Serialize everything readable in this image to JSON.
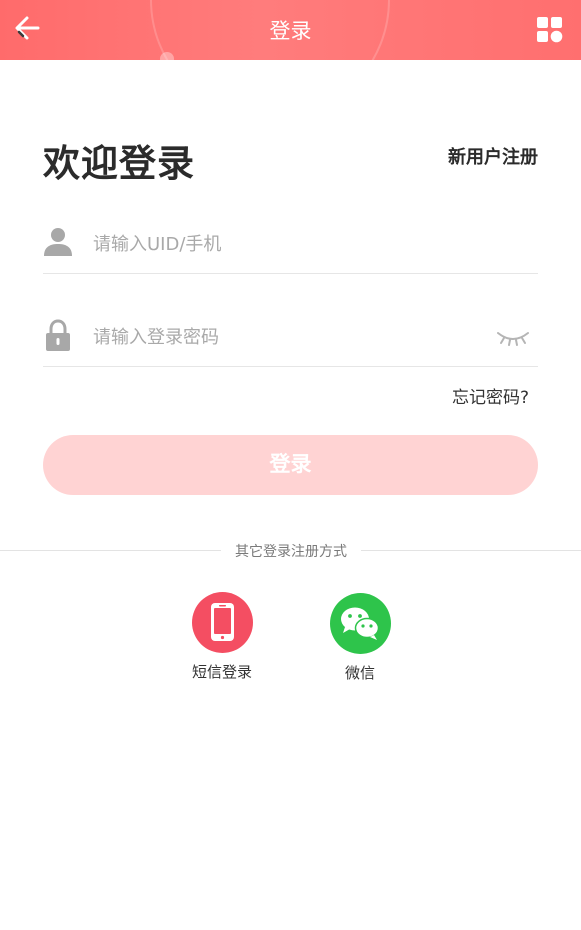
{
  "header": {
    "title": "登录",
    "back_icon": "back-arrow-icon",
    "menu_icon": "grid-apps-icon"
  },
  "main": {
    "welcome": "欢迎登录",
    "register_link": "新用户注册",
    "uid_field": {
      "placeholder": "请输入UID/手机",
      "value": "",
      "icon": "user-icon"
    },
    "password_field": {
      "placeholder": "请输入登录密码",
      "value": "",
      "icon": "lock-icon",
      "toggle_icon": "eye-closed-icon"
    },
    "forgot_password": "忘记密码?",
    "login_button": "登录"
  },
  "other_login": {
    "divider_text": "其它登录注册方式",
    "options": [
      {
        "label": "短信登录",
        "icon": "mobile-phone-icon",
        "color": "#f44e62"
      },
      {
        "label": "微信",
        "icon": "wechat-icon",
        "color": "#2ec44b"
      }
    ]
  },
  "colors": {
    "header_bg": "#ff6f6f",
    "login_button_bg": "#ffd3d3",
    "text_dark": "#2b2b2b"
  }
}
